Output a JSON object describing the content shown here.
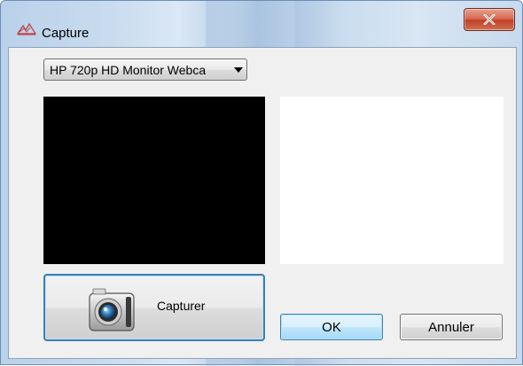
{
  "window": {
    "title": "Capture",
    "icon": "capture-app-icon",
    "close_icon": "close-icon"
  },
  "device": {
    "selected": "HP 720p HD Monitor Webca",
    "icon": "chevron-down-icon"
  },
  "capture_button": {
    "label": "Capturer",
    "icon": "camera-icon"
  },
  "buttons": {
    "ok": "OK",
    "cancel": "Annuler"
  },
  "colors": {
    "live_preview_bg": "#000000",
    "captured_preview_bg": "#ffffff",
    "close_button": "#c94a30",
    "focus_border": "#3c7fb1"
  }
}
